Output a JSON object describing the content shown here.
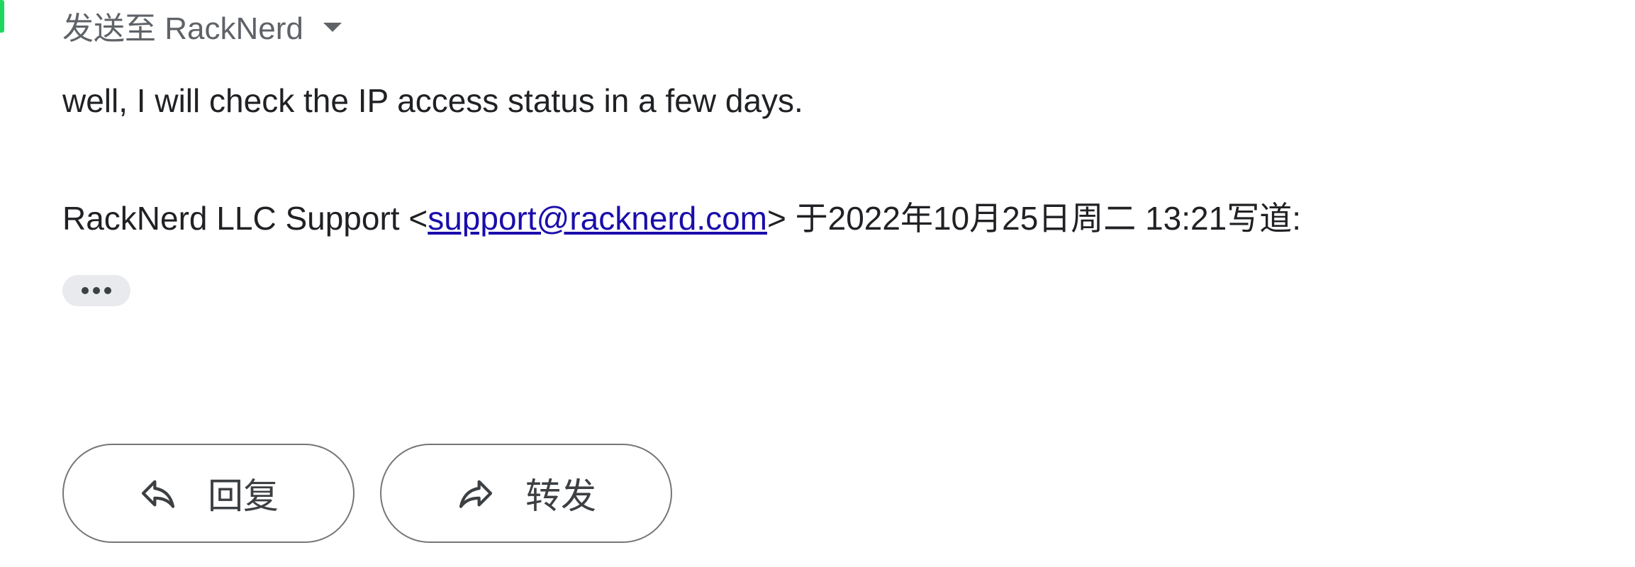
{
  "header": {
    "recipient_label": "发送至 RackNerd"
  },
  "message": {
    "body": "well, I will check the IP access status in a few days.",
    "quote_prefix": "RackNerd LLC Support <",
    "quote_email": "support@racknerd.com",
    "quote_suffix": "> 于2022年10月25日周二 13:21写道:"
  },
  "actions": {
    "reply_label": "回复",
    "forward_label": "转发"
  },
  "icons": {
    "dropdown": "caret-down-icon",
    "more": "ellipsis-icon",
    "reply": "reply-arrow-icon",
    "forward": "forward-arrow-icon"
  },
  "colors": {
    "accent_bar": "#1ed760",
    "link": "#1a0dab",
    "muted_text": "#5f6368",
    "button_border": "#747775"
  }
}
